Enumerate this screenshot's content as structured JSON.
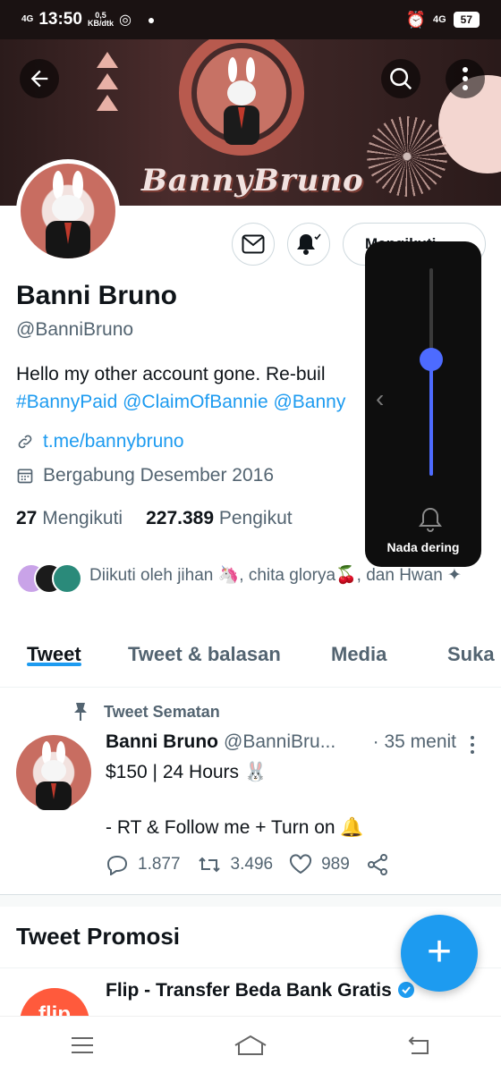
{
  "status_bar": {
    "signal": "4G",
    "time": "13:50",
    "speed_value": "0,5",
    "speed_unit": "KB/dtk",
    "network_right": "4G",
    "battery": "57"
  },
  "banner": {
    "brand_text": "BannyBruno"
  },
  "profile": {
    "name": "Banni Bruno",
    "handle": "@BanniBruno",
    "bio_line1": "Hello my other account gone. Re-buil",
    "bio_line2": "#BannyPaid @ClaimOfBannie @Banny",
    "link": "t.me/bannybruno",
    "joined": "Bergabung Desember 2016",
    "following_count": "27",
    "following_label": "Mengikuti",
    "followers_count": "227.389",
    "followers_label": "Pengikut",
    "followed_by": "Diikuti oleh jihan 🦄, chita glorya🍒, dan Hwan ✦",
    "follow_button": "Mengikuti"
  },
  "tabs": [
    {
      "label": "Tweet"
    },
    {
      "label": "Tweet & balasan"
    },
    {
      "label": "Media"
    },
    {
      "label": "Suka"
    }
  ],
  "pinned_tweet": {
    "pinned_label": "Tweet Sematan",
    "author": "Banni Bruno",
    "handle": "@BanniBru...",
    "time": "· 35 menit",
    "line1": "$150 | 24 Hours 🐰",
    "line2": "- RT & Follow me + Turn on 🔔",
    "replies": "1.877",
    "retweets": "3.496",
    "likes": "989"
  },
  "promoted": {
    "title": "Tweet Promosi",
    "item_title": "Flip - Transfer Beda Bank Gratis",
    "logo_text": "flip"
  },
  "volume_panel": {
    "label": "Nada dering",
    "level_fraction": 0.56
  },
  "colors": {
    "accent": "#1d9bf0",
    "volume_fill": "#4d6bff"
  }
}
